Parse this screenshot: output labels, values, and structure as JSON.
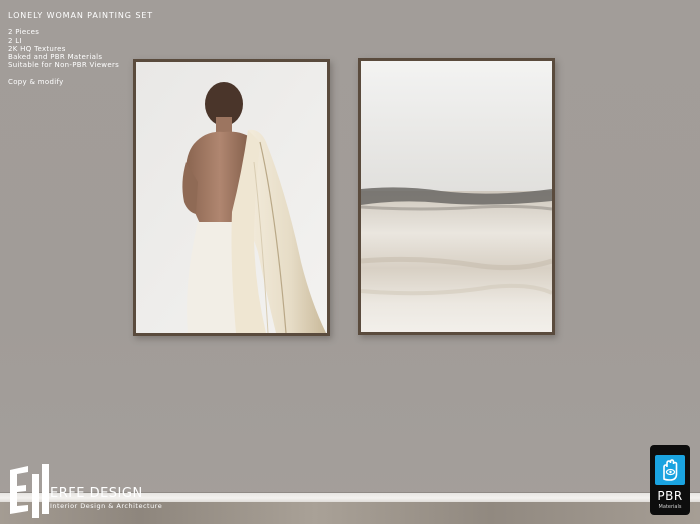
{
  "info": {
    "title": "LONELY WOMAN PAINTING SET",
    "lines": [
      "2 Pieces",
      "2 LI",
      "2K HQ Textures",
      "Baked and PBR Materials",
      "Suitable for Non-PBR Viewers"
    ],
    "extra": "Copy & modify"
  },
  "brand": {
    "name": "ERFE DESIGN",
    "tagline": "Interior Design & Architecture"
  },
  "badge": {
    "label": "PBR",
    "sublabel": "Materials",
    "color": "#1aa3e0"
  },
  "paintings": [
    {
      "subject": "woman-back-with-draped-coat"
    },
    {
      "subject": "abstract-horizon-landscape"
    }
  ]
}
